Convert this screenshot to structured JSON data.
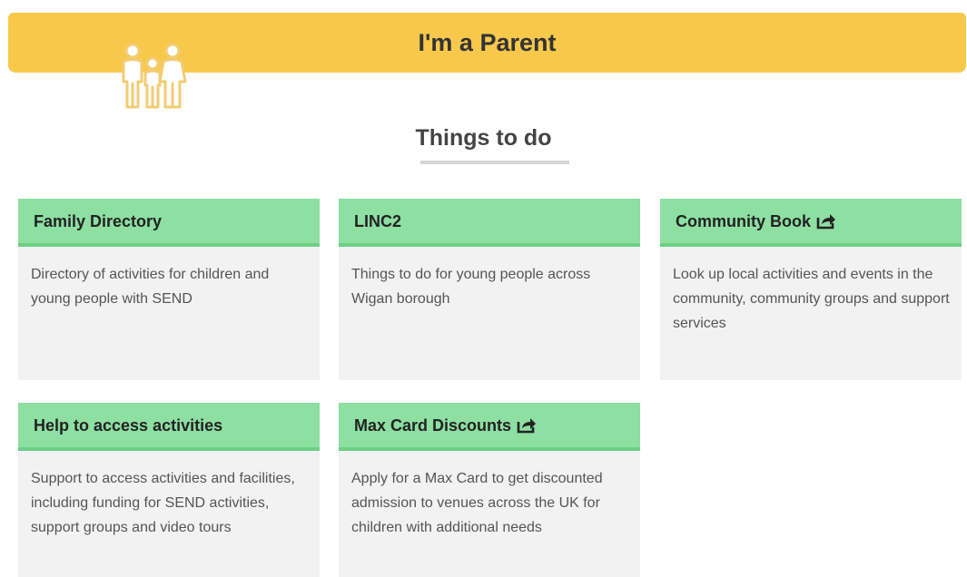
{
  "banner": {
    "title": "I'm a Parent",
    "icon": "family-icon"
  },
  "section": {
    "title": "Things to do"
  },
  "colors": {
    "banner": "#f8c84b",
    "card_header": "#8ddfa2",
    "card_body": "#f2f2f2"
  },
  "cards": [
    {
      "title": "Family Directory",
      "description": "Directory of activities for children and young people with SEND",
      "external": false
    },
    {
      "title": "LINC2",
      "description": "Things to do for young people across Wigan borough",
      "external": false
    },
    {
      "title": "Community Book",
      "description": "Look up local activities and events in the community, community groups and support services",
      "external": true
    },
    {
      "title": "Help to access activities",
      "description": "Support to access activities and facilities, including funding for SEND activities, support groups and video tours",
      "external": false
    },
    {
      "title": "Max Card Discounts",
      "description": "Apply for a Max Card to get discounted admission to venues across the UK for children with additional needs",
      "external": true
    }
  ]
}
